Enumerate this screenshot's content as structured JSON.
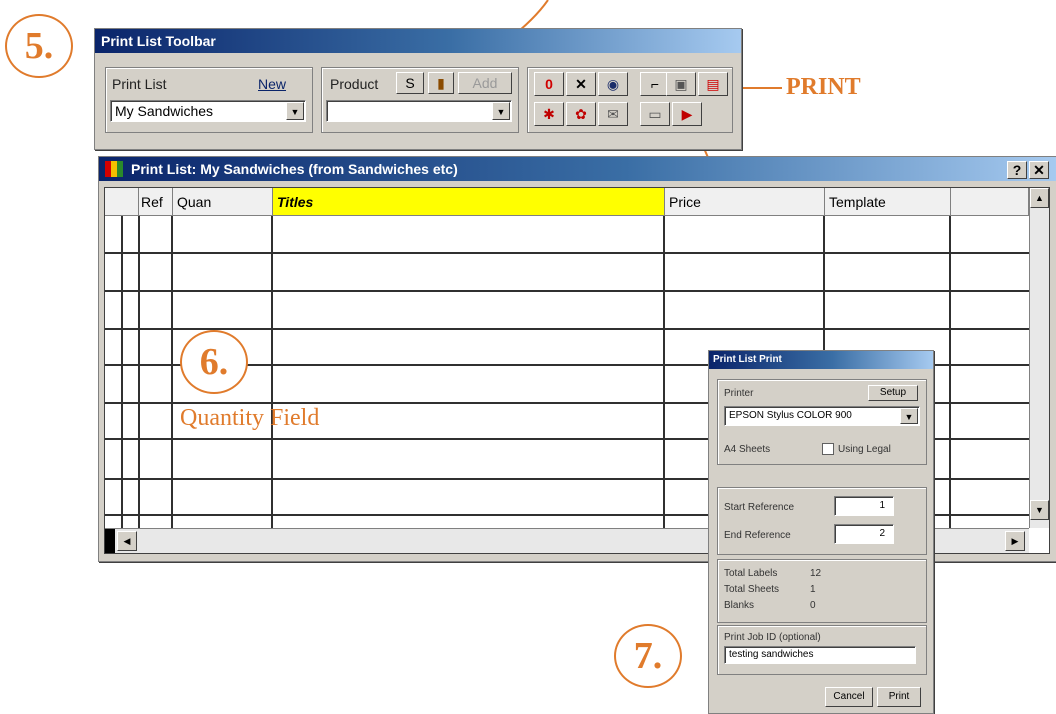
{
  "annotations": {
    "step5": "5.",
    "step6": "6.",
    "step7": "7.",
    "quantity_field": "Quantity Field",
    "print": "PRINT"
  },
  "toolbar": {
    "title": "Print List Toolbar",
    "print_list_label": "Print List",
    "new_label": "New",
    "print_list_value": "My Sandwiches",
    "product_label": "Product",
    "s_label": "S",
    "add_label": "Add",
    "product_value": ""
  },
  "list_window": {
    "title": "Print List: My Sandwiches (from Sandwiches etc)",
    "help": "?",
    "close": "✕",
    "columns": [
      "Ref",
      "Quan",
      "Titles",
      "Price",
      "Template"
    ]
  },
  "print_dialog": {
    "title": "Print List Print",
    "printer_label": "Printer",
    "setup_label": "Setup",
    "printer_value": "EPSON Stylus COLOR 900",
    "sheets_label": "A4 Sheets",
    "using_legal_label": "Using Legal",
    "start_ref_label": "Start Reference",
    "start_ref_value": "1",
    "end_ref_label": "End Reference",
    "end_ref_value": "2",
    "total_labels_label": "Total Labels",
    "total_labels_value": "12",
    "total_sheets_label": "Total Sheets",
    "total_sheets_value": "1",
    "blanks_label": "Blanks",
    "blanks_value": "0",
    "job_id_label": "Print Job ID (optional)",
    "job_id_value": "testing sandwiches",
    "cancel_label": "Cancel",
    "print_label": "Print"
  },
  "colors": {
    "accent": "#e07b2c",
    "titlebar": "#0a246a",
    "highlight": "#ffff00"
  }
}
